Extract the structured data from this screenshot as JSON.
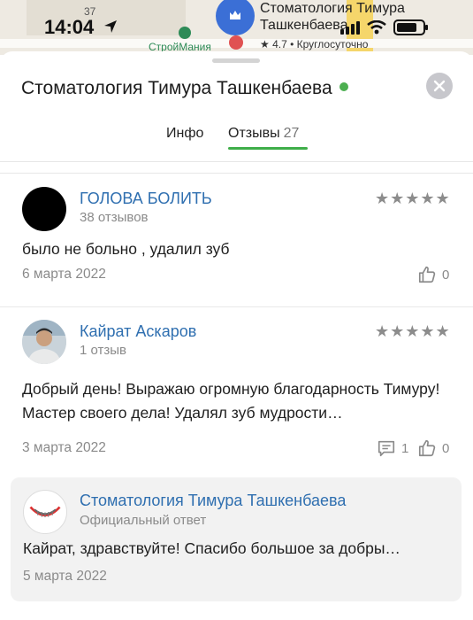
{
  "status_bar": {
    "time": "14:04"
  },
  "map": {
    "building_number": "37",
    "store_label": "СтройМания",
    "poi_name": "Стоматология Тимура Ташкенбаева",
    "poi_meta": "★ 4.7 • Круглосуточно"
  },
  "sheet": {
    "title": "Стоматология Тимура Ташкенбаева",
    "tabs": [
      {
        "label": "Инфо"
      },
      {
        "label": "Отзывы",
        "count": "27"
      }
    ]
  },
  "reviews": [
    {
      "author": "ГОЛОВА БОЛИТЬ",
      "reviews_count": "38 отзывов",
      "stars": "★★★★★",
      "text": "было не больно , удалил зуб",
      "date": "6 марта 2022",
      "likes": "0"
    },
    {
      "author": "Кайрат Аскаров",
      "reviews_count": "1 отзыв",
      "stars": "★★★★★",
      "text": "Добрый день! Выражаю огромную благодарность Тимуру! Мастер своего дела! Удалял зуб мудрости…",
      "date": "3 марта 2022",
      "comments": "1",
      "likes": "0"
    }
  ],
  "reply": {
    "author": "Стоматология Тимура Ташкенбаева",
    "label": "Официальный ответ",
    "text": "Кайрат, здравствуйте! Спасибо большое за добры…",
    "date": "5 марта 2022"
  },
  "colors": {
    "accent": "#3fae49",
    "link": "#2f6fb0"
  }
}
